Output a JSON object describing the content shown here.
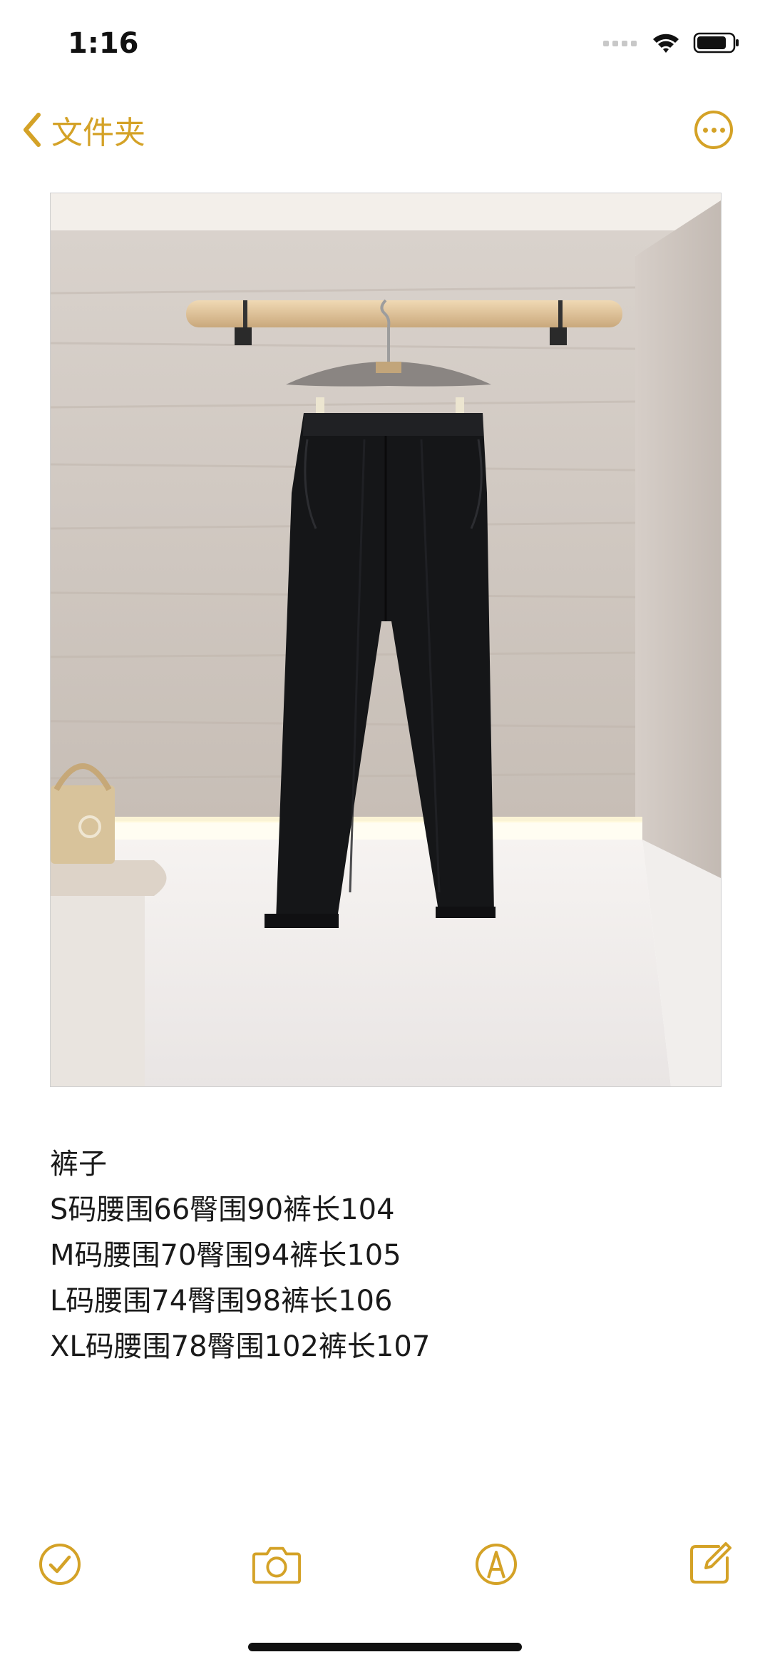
{
  "status_bar": {
    "time": "1:16"
  },
  "nav": {
    "back_label": "文件夹"
  },
  "note": {
    "lines": [
      "裤子",
      "S码腰围66臀围90裤长104",
      "M码腰围70臀围94裤长105",
      "L码腰围74臀围98裤长106",
      "XL码腰围78臀围102裤长107"
    ]
  },
  "toolbar": {
    "icons": [
      "checklist-icon",
      "camera-icon",
      "markup-icon",
      "compose-icon"
    ]
  },
  "colors": {
    "accent": "#d4a227",
    "text": "#1a1a1a",
    "background": "#ffffff"
  }
}
